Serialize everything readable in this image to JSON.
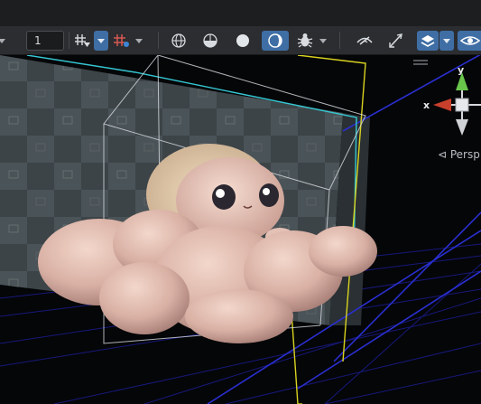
{
  "toolbar": {
    "frame_value": "1",
    "icons": [
      "grid-snap-icon",
      "snap-settings-icon",
      "wireframe-shading-icon",
      "solid-wire-shading-icon",
      "solid-shading-icon",
      "rendered-shading-icon",
      "bug-icon",
      "hide-icon",
      "transform-icon",
      "layers-icon",
      "visibility-eye-icon"
    ]
  },
  "viewport": {
    "projection_label": "⊲ Persp",
    "gizmo": {
      "x_label": "x",
      "y_label": "y"
    }
  },
  "colors": {
    "toolbar_bg": "#2c2d30",
    "active_button": "#3f6ea5",
    "grid_line": "#1b1c8e",
    "bbox_yellow": "#d9d320",
    "bbox_cyan": "#35c7d2",
    "axis_x": "#c8402c",
    "axis_y": "#69c64b"
  }
}
